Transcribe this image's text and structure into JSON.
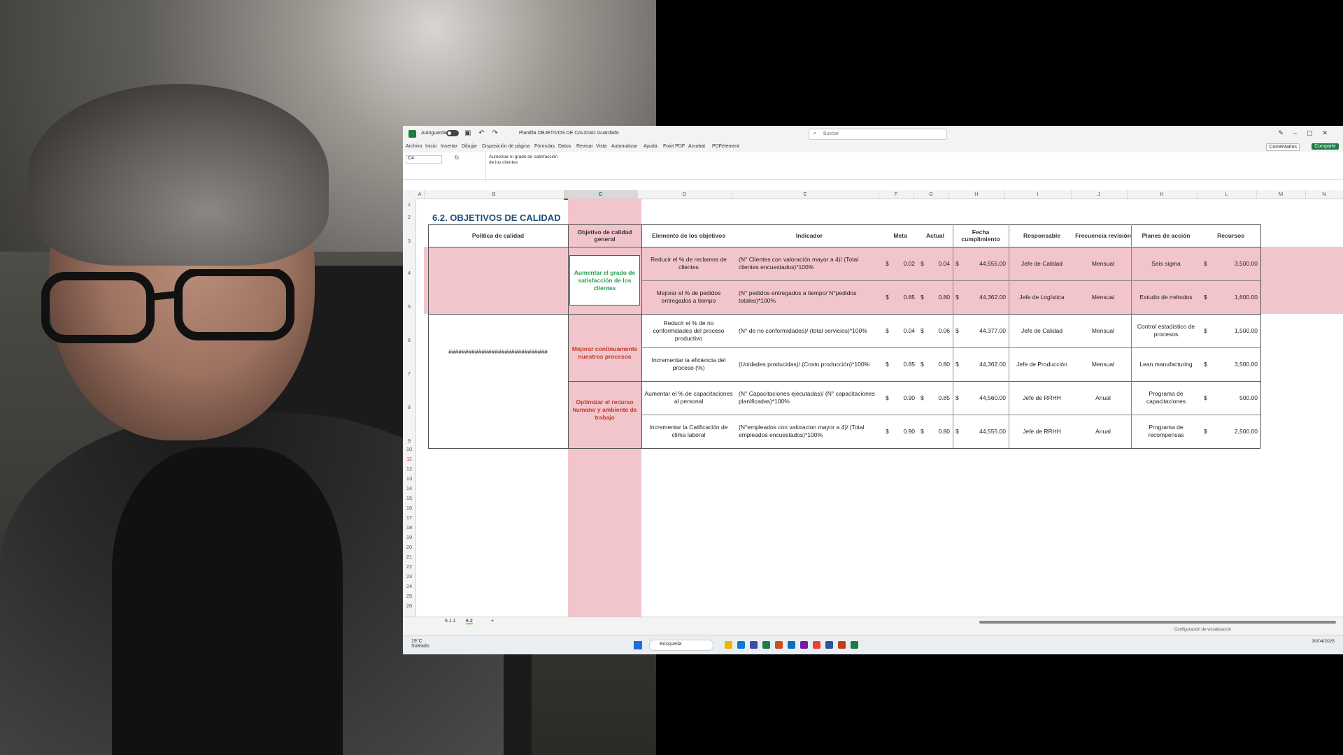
{
  "colors": {
    "pink": "#f2c5cc",
    "green_text": "#1fa64a",
    "red_text": "#c23b2a",
    "title_blue": "#1f4e79",
    "excel_green": "#1f7a43"
  },
  "window": {
    "autosave_label": "Autoguardado",
    "filename": "Plantilla OBJETIVOS DE CALIDAD Guardado",
    "search_placeholder": "Buscar",
    "comments_label": "Comentarios",
    "share_label": "Compartir"
  },
  "menu": [
    "Archivo",
    "Inicio",
    "Insertar",
    "Dibujar",
    "Disposición de página",
    "Fórmulas",
    "Datos",
    "Revisar",
    "Vista",
    "Automatizar",
    "Ayuda",
    "Foxit PDF",
    "Acrobat",
    "PDFelement"
  ],
  "formula_bar": {
    "name_box": "C4",
    "fx": "fx",
    "content": "Aumentar el grado de satisfacción\nde los clientes"
  },
  "columns": [
    "A",
    "B",
    "C",
    "D",
    "E",
    "F",
    "G",
    "H",
    "I",
    "J",
    "K",
    "L",
    "M",
    "N"
  ],
  "rows": [
    "1",
    "2",
    "3",
    "4",
    "5",
    "6",
    "7",
    "8",
    "9",
    "10",
    "11",
    "12",
    "13",
    "14",
    "15",
    "16",
    "17",
    "18",
    "19",
    "20",
    "21",
    "22",
    "23",
    "24",
    "25",
    "26"
  ],
  "sheet": {
    "title": "6.2. OBJETIVOS DE CALIDAD",
    "headers": [
      "Política de calidad",
      "Objetivo de calidad general",
      "Elemento de los objetivos",
      "Indicador",
      "Meta",
      "Actual",
      "Fecha cumplimiento",
      "Responsable",
      "Frecuencia revisión",
      "Planes de acción",
      "Recursos"
    ],
    "policy_value": "##############################",
    "currency": "$",
    "objectives": [
      {
        "label": "Aumentar el grado de satisfacción de los clientes"
      },
      {
        "label": "Mejorar continuamente nuestros procesos"
      },
      {
        "label": "Optimizar el recurso humano y ambiente de trabajo"
      }
    ],
    "rows": [
      {
        "element": "Reducir el % de reclamos de clientes",
        "indicator": "(N° Clientes con valoración mayor a 4)/ (Total clientes encuestados)*100%",
        "meta": "0.02",
        "actual": "0.04",
        "fecha": "44,555.00",
        "responsable": "Jefe de Calidad",
        "frecuencia": "Mensual",
        "plan": "Seis sigma",
        "recursos": "3,500.00"
      },
      {
        "element": "Mejorar el % de pedidos entregados a tiempo",
        "indicator": "(N° pedidos entregados a tiempo/ N°pedidos totales)*100%",
        "meta": "0.85",
        "actual": "0.80",
        "fecha": "44,362.00",
        "responsable": "Jefe de Logística",
        "frecuencia": "Mensual",
        "plan": "Estudio de métodos",
        "recursos": "1,600.00"
      },
      {
        "element": "Reducir el % de no conformidades del proceso productivo",
        "indicator": "(N° de no conformidades)/ (total servicios)*100%",
        "meta": "0.04",
        "actual": "0.06",
        "fecha": "44,377.00",
        "responsable": "Jefe de Calidad",
        "frecuencia": "Mensual",
        "plan": "Control estadístico de procesos",
        "recursos": "1,500.00"
      },
      {
        "element": "Incrementar la eficiencia del proceso (%)",
        "indicator": "(Unidades producidas)/ (Costo producción)*100%",
        "meta": "0.85",
        "actual": "0.80",
        "fecha": "44,362.00",
        "responsable": "Jefe de Producción",
        "frecuencia": "Mensual",
        "plan": "Lean manufacturing",
        "recursos": "3,500.00"
      },
      {
        "element": "Aumentar el % de capacitaciones al personal",
        "indicator": "(N° Capacitaciones ejecutadas)/ (N° capacitaciones planificadas)*100%",
        "meta": "0.90",
        "actual": "0.85",
        "fecha": "44,560.00",
        "responsable": "Jefe de RRHH",
        "frecuencia": "Anual",
        "plan": "Programa de capacitaciones",
        "recursos": "500.00"
      },
      {
        "element": "Incrementar la Calificación de clima laboral",
        "indicator": "(N°empleados con valoracion mayor a 4)/ (Total empleados encuestados)*100%",
        "meta": "0.90",
        "actual": "0.80",
        "fecha": "44,555.00",
        "responsable": "Jefe de RRHH",
        "frecuencia": "Anual",
        "plan": "Programa de recompensas",
        "recursos": "2,500.00"
      }
    ],
    "tabs": [
      "6.1.1",
      "6.2"
    ]
  },
  "statusbar": {
    "zoom_label": "Configuración de visualización"
  },
  "taskbar": {
    "search_label": "Búsqueda",
    "weather_temp": "19°C",
    "weather_desc": "Soleado",
    "date": "30/04/2025"
  }
}
